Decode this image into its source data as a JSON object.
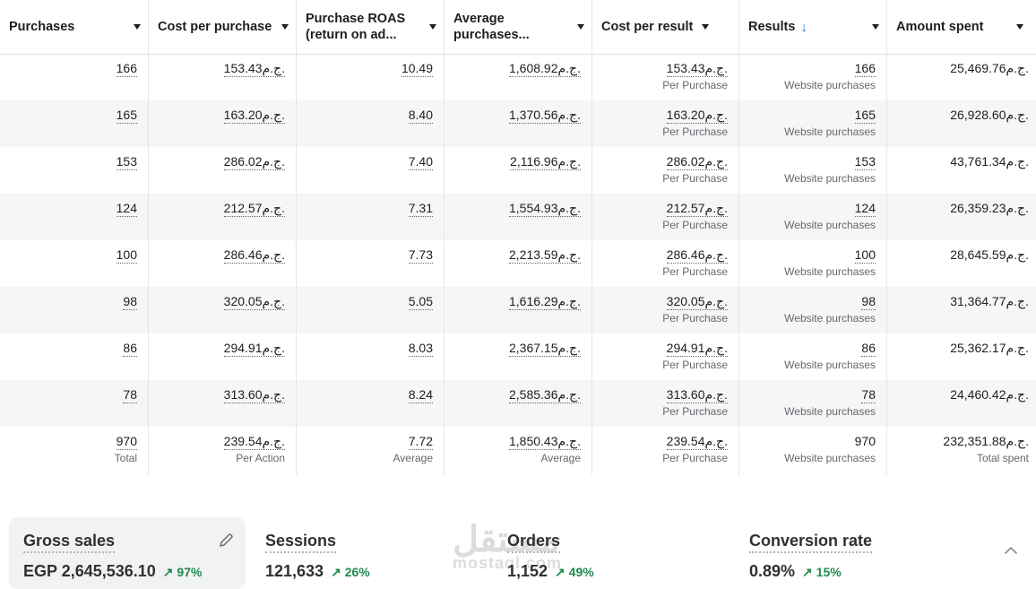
{
  "columns": [
    {
      "label": "Purchases",
      "sort": false
    },
    {
      "label": "Cost per purchase",
      "sort": false
    },
    {
      "label": "Purchase ROAS (return on ad...",
      "sort": false
    },
    {
      "label": "Average purchases...",
      "sort": false
    },
    {
      "label": "Cost per result",
      "sort": false
    },
    {
      "label": "Results",
      "sort": true
    },
    {
      "label": "Amount spent",
      "sort": false
    }
  ],
  "sort_arrow": "↓",
  "rows": [
    {
      "purchases": "166",
      "cpp": "153.43ج.م.",
      "roas": "10.49",
      "avg": "1,608.92ج.م.",
      "cpr": "153.43ج.م.",
      "cpr_sub": "Per Purchase",
      "results": "166",
      "results_sub": "Website purchases",
      "spent": "25,469.76ج.م."
    },
    {
      "purchases": "165",
      "cpp": "163.20ج.م.",
      "roas": "8.40",
      "avg": "1,370.56ج.م.",
      "cpr": "163.20ج.م.",
      "cpr_sub": "Per Purchase",
      "results": "165",
      "results_sub": "Website purchases",
      "spent": "26,928.60ج.م."
    },
    {
      "purchases": "153",
      "cpp": "286.02ج.م.",
      "roas": "7.40",
      "avg": "2,116.96ج.م.",
      "cpr": "286.02ج.م.",
      "cpr_sub": "Per Purchase",
      "results": "153",
      "results_sub": "Website purchases",
      "spent": "43,761.34ج.م."
    },
    {
      "purchases": "124",
      "cpp": "212.57ج.م.",
      "roas": "7.31",
      "avg": "1,554.93ج.م.",
      "cpr": "212.57ج.م.",
      "cpr_sub": "Per Purchase",
      "results": "124",
      "results_sub": "Website purchases",
      "spent": "26,359.23ج.م."
    },
    {
      "purchases": "100",
      "cpp": "286.46ج.م.",
      "roas": "7.73",
      "avg": "2,213.59ج.م.",
      "cpr": "286.46ج.م.",
      "cpr_sub": "Per Purchase",
      "results": "100",
      "results_sub": "Website purchases",
      "spent": "28,645.59ج.م."
    },
    {
      "purchases": "98",
      "cpp": "320.05ج.م.",
      "roas": "5.05",
      "avg": "1,616.29ج.م.",
      "cpr": "320.05ج.م.",
      "cpr_sub": "Per Purchase",
      "results": "98",
      "results_sub": "Website purchases",
      "spent": "31,364.77ج.م."
    },
    {
      "purchases": "86",
      "cpp": "294.91ج.م.",
      "roas": "8.03",
      "avg": "2,367.15ج.م.",
      "cpr": "294.91ج.م.",
      "cpr_sub": "Per Purchase",
      "results": "86",
      "results_sub": "Website purchases",
      "spent": "25,362.17ج.م."
    },
    {
      "purchases": "78",
      "cpp": "313.60ج.م.",
      "roas": "8.24",
      "avg": "2,585.36ج.م.",
      "cpr": "313.60ج.م.",
      "cpr_sub": "Per Purchase",
      "results": "78",
      "results_sub": "Website purchases",
      "spent": "24,460.42ج.م."
    }
  ],
  "totals": {
    "purchases": "970",
    "purchases_sub": "Total",
    "cpp": "239.54ج.م.",
    "cpp_sub": "Per Action",
    "roas": "7.72",
    "roas_sub": "Average",
    "avg": "1,850.43ج.م.",
    "avg_sub": "Average",
    "cpr": "239.54ج.م.",
    "cpr_sub": "Per Purchase",
    "results": "970",
    "results_sub": "Website purchases",
    "spent": "232,351.88ج.م.",
    "spent_sub": "Total spent"
  },
  "kpis": [
    {
      "title": "Gross sales",
      "value": "EGP 2,645,536.10",
      "delta": "↗ 97%"
    },
    {
      "title": "Sessions",
      "value": "121,633",
      "delta": "↗ 26%"
    },
    {
      "title": "Orders",
      "value": "1,152",
      "delta": "↗ 49%"
    },
    {
      "title": "Conversion rate",
      "value": "0.89%",
      "delta": "↗ 15%"
    }
  ],
  "watermark": {
    "arabic": "مستقل",
    "latin": "mostaql.com"
  },
  "icons": {
    "pencil": "pencil-icon",
    "collapse": "chevron-up-icon",
    "caret": "caret-down-icon",
    "sort": "sort-down-arrow-icon"
  },
  "colors": {
    "accent": "#1877f2",
    "positive": "#1f8a4c",
    "row_alt": "#f5f6f7"
  }
}
